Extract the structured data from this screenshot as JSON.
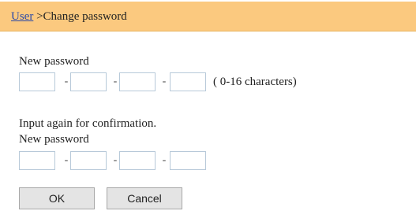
{
  "breadcrumb": {
    "parent_link": "User",
    "separator": " >",
    "current": "Change password"
  },
  "section1": {
    "new_password_label": "New password",
    "fields": [
      "",
      "",
      "",
      ""
    ],
    "separator": "-",
    "hint": "( 0-16 characters)"
  },
  "section2": {
    "confirm_instruction": "Input again for confirmation.",
    "new_password_label": "New password",
    "fields": [
      "",
      "",
      "",
      ""
    ],
    "separator": "-"
  },
  "buttons": {
    "ok_label": "OK",
    "cancel_label": "Cancel"
  },
  "colors": {
    "header_bg": "#fbc97f",
    "link": "#2a49a8",
    "field_border": "#b7c9d9",
    "button_bg": "#e4e4e4"
  }
}
